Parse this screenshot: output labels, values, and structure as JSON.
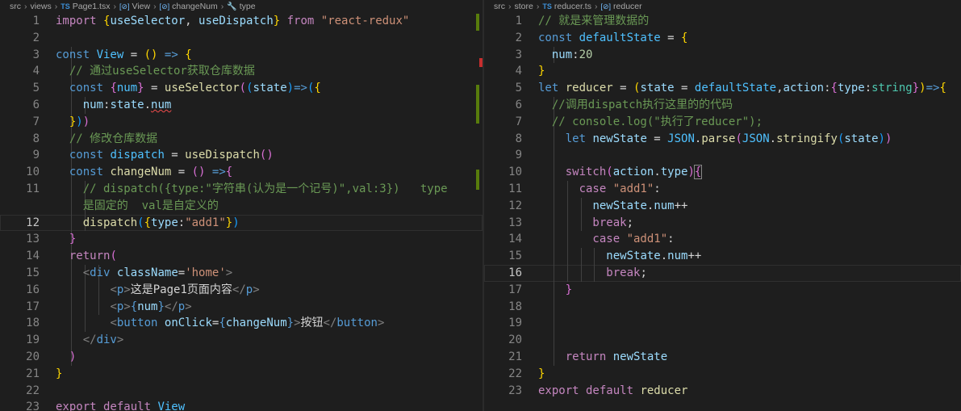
{
  "left_editor": {
    "breadcrumb": [
      "src",
      "views",
      "Page1.tsx",
      "View",
      "changeNum",
      "type"
    ],
    "current_line": 12,
    "line_numbers": [
      "1",
      "2",
      "3",
      "4",
      "5",
      "6",
      "7",
      "8",
      "9",
      "10",
      "11",
      "",
      "12",
      "13",
      "14",
      "15",
      "16",
      "17",
      "18",
      "19",
      "20",
      "21",
      "22",
      "23"
    ],
    "lines": [
      [
        [
          "kw",
          "import "
        ],
        [
          "b1",
          "{"
        ],
        [
          "vr",
          "useSelector"
        ],
        [
          "pl",
          ", "
        ],
        [
          "vr",
          "useDispatch"
        ],
        [
          "b1",
          "}"
        ],
        [
          "kw",
          " from "
        ],
        [
          "sr",
          "\"react-redux\""
        ]
      ],
      [],
      [
        [
          "st",
          "const "
        ],
        [
          "cn",
          "View"
        ],
        [
          "pl",
          " = "
        ],
        [
          "b1",
          "("
        ],
        [
          "b1",
          ")"
        ],
        [
          "st",
          " => "
        ],
        [
          "b1",
          "{"
        ]
      ],
      [
        [
          "cm",
          "  // 通过useSelector获取仓库数据"
        ]
      ],
      [
        [
          "st",
          "  const "
        ],
        [
          "b2",
          "{"
        ],
        [
          "cn",
          "num"
        ],
        [
          "b2",
          "}"
        ],
        [
          "pl",
          " = "
        ],
        [
          "fn",
          "useSelector"
        ],
        [
          "b2",
          "("
        ],
        [
          "b3",
          "("
        ],
        [
          "vr",
          "state"
        ],
        [
          "b3",
          ")"
        ],
        [
          "st",
          "=>"
        ],
        [
          "b3",
          "("
        ],
        [
          "b1",
          "{"
        ]
      ],
      [
        [
          "pl",
          "    "
        ],
        [
          "vr",
          "num"
        ],
        [
          "pl",
          ":"
        ],
        [
          "vr",
          "state"
        ],
        [
          "pl",
          "."
        ],
        [
          "vr",
          "num"
        ]
      ],
      [
        [
          "pl",
          "  "
        ],
        [
          "b1",
          "}"
        ],
        [
          "b3",
          ")"
        ],
        [
          "b2",
          ")"
        ]
      ],
      [
        [
          "cm",
          "  // 修改仓库数据"
        ]
      ],
      [
        [
          "st",
          "  const "
        ],
        [
          "cn",
          "dispatch"
        ],
        [
          "pl",
          " = "
        ],
        [
          "fn",
          "useDispatch"
        ],
        [
          "b2",
          "("
        ],
        [
          "b2",
          ")"
        ]
      ],
      [
        [
          "st",
          "  const "
        ],
        [
          "fn",
          "changeNum"
        ],
        [
          "pl",
          " = "
        ],
        [
          "b2",
          "("
        ],
        [
          "b2",
          ")"
        ],
        [
          "st",
          " =>"
        ],
        [
          "b2",
          "{"
        ]
      ],
      [
        [
          "cm",
          "    // dispatch({type:\"字符串(认为是一个记号)\",val:3})   type"
        ]
      ],
      [
        [
          "cm",
          "    是固定的  val是自定义的"
        ]
      ],
      [
        [
          "pl",
          "    "
        ],
        [
          "fn",
          "dispatch"
        ],
        [
          "b3",
          "("
        ],
        [
          "b1",
          "{"
        ],
        [
          "vr",
          "type"
        ],
        [
          "pl",
          ":"
        ],
        [
          "sr",
          "\"add1\""
        ],
        [
          "b1",
          "}"
        ],
        [
          "b3",
          ")"
        ]
      ],
      [
        [
          "pl",
          "  "
        ],
        [
          "b2",
          "}"
        ]
      ],
      [
        [
          "pl",
          "  "
        ],
        [
          "kw",
          "return"
        ],
        [
          "b2",
          "("
        ]
      ],
      [
        [
          "pl",
          "    "
        ],
        [
          "ab",
          "<"
        ],
        [
          "tg",
          "div"
        ],
        [
          "pl",
          " "
        ],
        [
          "vr",
          "className"
        ],
        [
          "pl",
          "="
        ],
        [
          "sr",
          "'home'"
        ],
        [
          "ab",
          ">"
        ]
      ],
      [
        [
          "pl",
          "        "
        ],
        [
          "ab",
          "<"
        ],
        [
          "tg",
          "p"
        ],
        [
          "ab",
          ">"
        ],
        [
          "pl",
          "这是Page1页面内容"
        ],
        [
          "ab",
          "</"
        ],
        [
          "tg",
          "p"
        ],
        [
          "ab",
          ">"
        ]
      ],
      [
        [
          "pl",
          "        "
        ],
        [
          "ab",
          "<"
        ],
        [
          "tg",
          "p"
        ],
        [
          "ab",
          ">"
        ],
        [
          "st",
          "{"
        ],
        [
          "vr",
          "num"
        ],
        [
          "st",
          "}"
        ],
        [
          "ab",
          "</"
        ],
        [
          "tg",
          "p"
        ],
        [
          "ab",
          ">"
        ]
      ],
      [
        [
          "pl",
          "        "
        ],
        [
          "ab",
          "<"
        ],
        [
          "tg",
          "button"
        ],
        [
          "pl",
          " "
        ],
        [
          "vr",
          "onClick"
        ],
        [
          "pl",
          "="
        ],
        [
          "st",
          "{"
        ],
        [
          "vr",
          "changeNum"
        ],
        [
          "st",
          "}"
        ],
        [
          "ab",
          ">"
        ],
        [
          "pl",
          "按钮"
        ],
        [
          "ab",
          "</"
        ],
        [
          "tg",
          "button"
        ],
        [
          "ab",
          ">"
        ]
      ],
      [
        [
          "pl",
          "    "
        ],
        [
          "ab",
          "</"
        ],
        [
          "tg",
          "div"
        ],
        [
          "ab",
          ">"
        ]
      ],
      [
        [
          "pl",
          "  "
        ],
        [
          "b2",
          ")"
        ]
      ],
      [
        [
          "b1",
          "}"
        ]
      ],
      [],
      [
        [
          "kw",
          "export default "
        ],
        [
          "cn",
          "View"
        ]
      ]
    ]
  },
  "right_editor": {
    "breadcrumb": [
      "src",
      "store",
      "reducer.ts",
      "reducer"
    ],
    "current_line": 16,
    "line_numbers": [
      "1",
      "2",
      "3",
      "4",
      "5",
      "6",
      "7",
      "8",
      "9",
      "10",
      "11",
      "12",
      "13",
      "14",
      "15",
      "16",
      "17",
      "18",
      "19",
      "20",
      "21",
      "22",
      "23"
    ],
    "lines": [
      [
        [
          "cm",
          "// 就是来管理数据的"
        ]
      ],
      [
        [
          "st",
          "const "
        ],
        [
          "cn",
          "defaultState"
        ],
        [
          "pl",
          " = "
        ],
        [
          "b1",
          "{"
        ]
      ],
      [
        [
          "pl",
          "  "
        ],
        [
          "vr",
          "num"
        ],
        [
          "pl",
          ":"
        ],
        [
          "nm",
          "20"
        ]
      ],
      [
        [
          "b1",
          "}"
        ]
      ],
      [
        [
          "st",
          "let "
        ],
        [
          "fn",
          "reducer"
        ],
        [
          "pl",
          " = "
        ],
        [
          "b1",
          "("
        ],
        [
          "vr",
          "state"
        ],
        [
          "pl",
          " = "
        ],
        [
          "cn",
          "defaultState"
        ],
        [
          "pl",
          ","
        ],
        [
          "vr",
          "action"
        ],
        [
          "pl",
          ":"
        ],
        [
          "b2",
          "{"
        ],
        [
          "vr",
          "type"
        ],
        [
          "pl",
          ":"
        ],
        [
          "ty",
          "string"
        ],
        [
          "b2",
          "}"
        ],
        [
          "b1",
          ")"
        ],
        [
          "st",
          "=>"
        ],
        [
          "b1",
          "{"
        ]
      ],
      [
        [
          "cm",
          "  //调用dispatch执行这里的的代码"
        ]
      ],
      [
        [
          "cm",
          "  // console.log(\"执行了reducer\");"
        ]
      ],
      [
        [
          "st",
          "    let "
        ],
        [
          "vr",
          "newState"
        ],
        [
          "pl",
          " = "
        ],
        [
          "cn",
          "JSON"
        ],
        [
          "pl",
          "."
        ],
        [
          "fn",
          "parse"
        ],
        [
          "b2",
          "("
        ],
        [
          "cn",
          "JSON"
        ],
        [
          "pl",
          "."
        ],
        [
          "fn",
          "stringify"
        ],
        [
          "b3",
          "("
        ],
        [
          "vr",
          "state"
        ],
        [
          "b3",
          ")"
        ],
        [
          "b2",
          ")"
        ]
      ],
      [],
      [
        [
          "kw",
          "    switch"
        ],
        [
          "b2",
          "("
        ],
        [
          "vr",
          "action"
        ],
        [
          "pl",
          "."
        ],
        [
          "vr",
          "type"
        ],
        [
          "b2",
          ")"
        ],
        [
          "b2",
          "{"
        ]
      ],
      [
        [
          "kw",
          "      case "
        ],
        [
          "sr",
          "\"add1\""
        ],
        [
          "pl",
          ":"
        ]
      ],
      [
        [
          "pl",
          "        "
        ],
        [
          "vr",
          "newState"
        ],
        [
          "pl",
          "."
        ],
        [
          "vr",
          "num"
        ],
        [
          "pl",
          "++"
        ]
      ],
      [
        [
          "kw",
          "        break"
        ],
        [
          "pl",
          ";"
        ]
      ],
      [
        [
          "kw",
          "        case "
        ],
        [
          "sr",
          "\"add1\""
        ],
        [
          "pl",
          ":"
        ]
      ],
      [
        [
          "pl",
          "          "
        ],
        [
          "vr",
          "newState"
        ],
        [
          "pl",
          "."
        ],
        [
          "vr",
          "num"
        ],
        [
          "pl",
          "++"
        ]
      ],
      [
        [
          "kw",
          "          break"
        ],
        [
          "pl",
          ";"
        ]
      ],
      [
        [
          "pl",
          "    "
        ],
        [
          "b2",
          "}"
        ]
      ],
      [],
      [],
      [],
      [
        [
          "kw",
          "    return "
        ],
        [
          "vr",
          "newState"
        ]
      ],
      [
        [
          "b1",
          "}"
        ]
      ],
      [
        [
          "kw",
          "export default "
        ],
        [
          "fn",
          "reducer"
        ]
      ]
    ]
  }
}
